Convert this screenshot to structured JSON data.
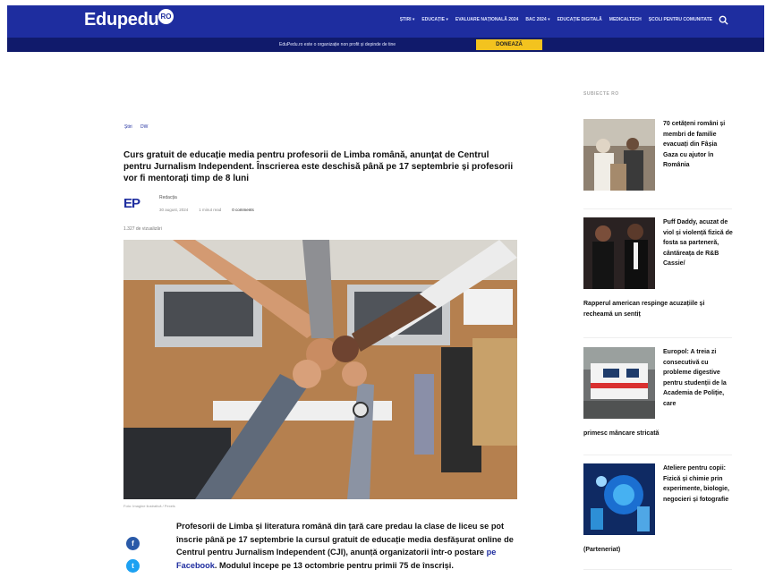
{
  "header": {
    "logo": "Edupedu",
    "logo_badge": "RO",
    "nav": [
      "ȘTIRI ▾",
      "EDUCAȚIE ▾",
      "EVALUARE NAȚIONALĂ 2024",
      "BAC 2024 ▾",
      "EDUCAȚIE DIGITALĂ",
      "MEDICALTECH",
      "ȘCOLI PENTRU COMUNITATE"
    ],
    "search_icon": "search-icon"
  },
  "donate": {
    "text": "EduPedu.ro este o organizație non profit și depinde de tine",
    "button": "DONEAZĂ"
  },
  "article": {
    "breadcrumb": [
      "Știri",
      "DW"
    ],
    "title": "Curs gratuit de educație media pentru profesorii de Limba română, anunțat de Centrul pentru Jurnalism Independent. Înscrierea este deschisă până pe 17 septembrie și profesorii vor fi mentorați timp de 8 luni",
    "avatar": "EP",
    "author": "Redacția",
    "date": "30 august, 2024",
    "read_time": "1 minut read",
    "comments": "0 comments",
    "reads": "1.327 de vizualizări",
    "image_credit": "Foto: Imagine ilustrativă / Pexels",
    "lead_before_link": "Profesorii de Limba și literatura română din țară care predau la clase de liceu se pot înscrie până pe 17 septembrie la cursul gratuit de educație media desfășurat online de Centrul pentru Jurnalism Independent (CJI), anunță organizatorii într-o postare ",
    "lead_link": "pe Facebook",
    "lead_after_link": ". Modulul începe pe 13 octombrie pentru primii 75 de înscriși."
  },
  "sidebar": {
    "heading": "SUBIECTE RO",
    "items": [
      {
        "text": "70 cetățeni români și membri de familie evacuați din Fâșia Gaza cu ajutor în România",
        "cont": ""
      },
      {
        "text": "Puff Daddy, acuzat de viol și violență fizică de fosta sa parteneră, cântăreața de R&B Cassie/",
        "cont": "Rapperul american respinge acuzațiile și recheamă un sentiț"
      },
      {
        "text": "Europol: A treia zi consecutivă cu probleme digestive pentru studenții de la Academia de Poliție, care",
        "cont": "primesc mâncare stricată"
      },
      {
        "text": "Ateliere pentru copii: Fizică și chimie prin experimente, biologie, negocieri și fotografie",
        "cont": "(Parteneriat)"
      }
    ]
  },
  "colors": {
    "brand": "#1e2d9f",
    "brand_dark": "#101a6b",
    "donate_button": "#f3c31f",
    "link": "#1e2d9f"
  }
}
